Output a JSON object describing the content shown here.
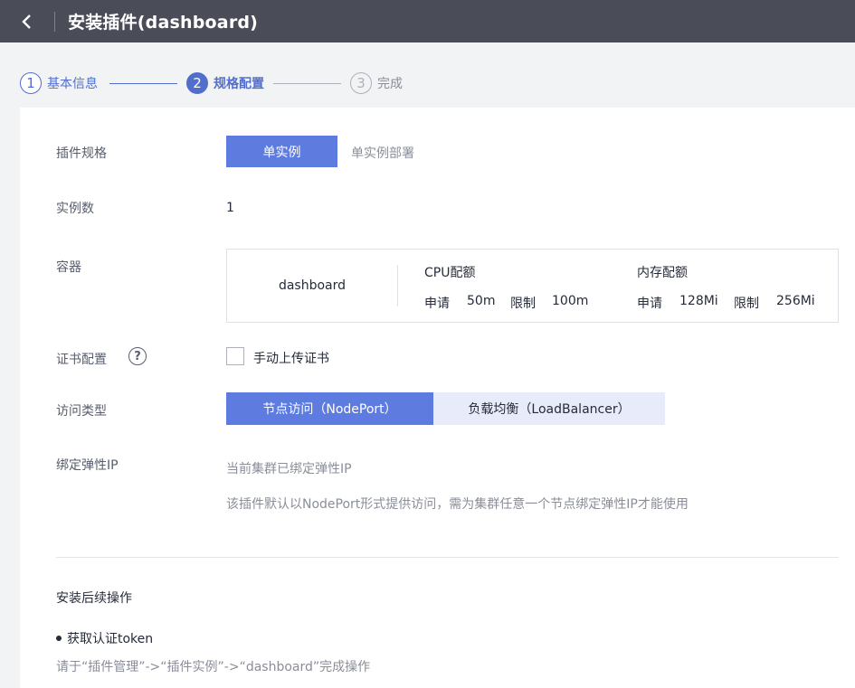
{
  "header": {
    "title": "安装插件(dashboard)"
  },
  "stepper": {
    "steps": [
      {
        "number": "1",
        "label": "基本信息",
        "state": "done"
      },
      {
        "number": "2",
        "label": "规格配置",
        "state": "active"
      },
      {
        "number": "3",
        "label": "完成",
        "state": "pending"
      }
    ]
  },
  "form": {
    "spec": {
      "label": "插件规格",
      "button": "单实例",
      "description": "单实例部署"
    },
    "instances": {
      "label": "实例数",
      "value": "1"
    },
    "container": {
      "label": "容器",
      "name": "dashboard",
      "cpu": {
        "title": "CPU配额",
        "request_label": "申请",
        "request_value": "50m",
        "limit_label": "限制",
        "limit_value": "100m"
      },
      "memory": {
        "title": "内存配额",
        "request_label": "申请",
        "request_value": "128Mi",
        "limit_label": "限制",
        "limit_value": "256Mi"
      }
    },
    "cert": {
      "label": "证书配置",
      "help_icon": "?",
      "checkbox_label": "手动上传证书",
      "checked": false
    },
    "access": {
      "label": "访问类型",
      "options": [
        {
          "label": "节点访问（NodePort）",
          "selected": true
        },
        {
          "label": "负载均衡（LoadBalancer）",
          "selected": false
        }
      ]
    },
    "eip": {
      "label": "绑定弹性IP",
      "line1": "当前集群已绑定弹性IP",
      "line2": "该插件默认以NodePort形式提供访问，需为集群任意一个节点绑定弹性IP才能使用"
    }
  },
  "followup": {
    "title": "安装后续操作",
    "item": "获取认证token",
    "description": "请于“插件管理”->“插件实例”->“dashboard”完成操作"
  },
  "colors": {
    "header_bg": "#4a4c57",
    "accent": "#5e7ce0",
    "step_accent": "#526ecc"
  }
}
